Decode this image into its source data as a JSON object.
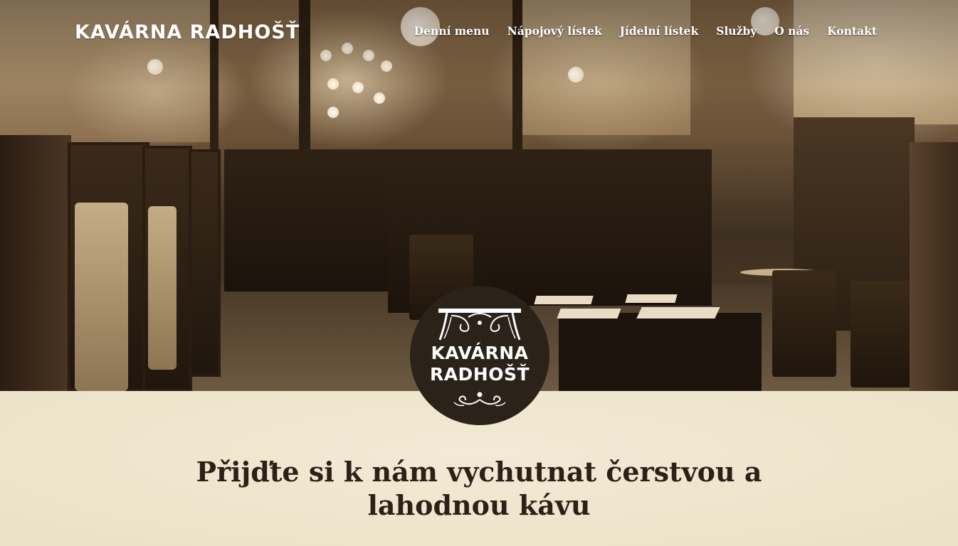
{
  "brand": {
    "name": "KAVÁRNA RADHOŠŤ"
  },
  "nav": {
    "items": [
      {
        "label": "Denní menu"
      },
      {
        "label": "Nápojový lístek"
      },
      {
        "label": "Jídelní lístek"
      },
      {
        "label": "Služby"
      },
      {
        "label": "O nás"
      },
      {
        "label": "Kontakt"
      }
    ]
  },
  "logo_badge": {
    "line1": "KAVÁRNA",
    "line2": "RADHOŠŤ"
  },
  "hero_image": {
    "alt": "cafe interior photo"
  },
  "headline": {
    "line1": "Přijďte si k nám vychutnat čerstvou a",
    "line2": "lahodnou kávu"
  },
  "colors": {
    "badge_bg": "#2b221a",
    "content_bg": "#efe6cf",
    "headline_text": "#2b2118",
    "nav_text": "#ffffff"
  }
}
